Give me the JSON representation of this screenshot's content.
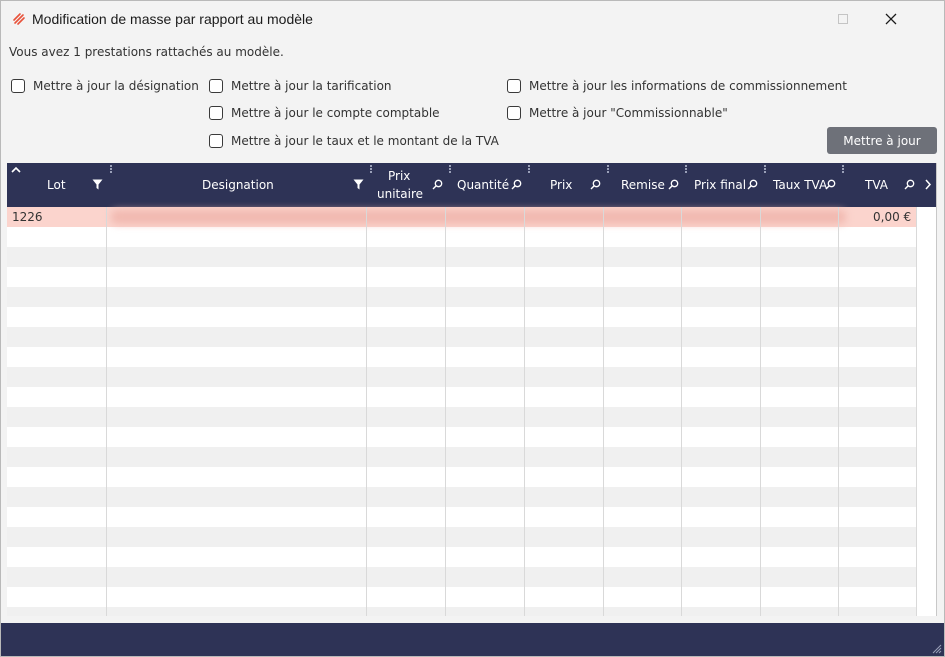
{
  "window": {
    "title": "Modification de masse par rapport au modèle",
    "minimize_icon": "minimize-icon",
    "maximize_icon": "maximize-icon",
    "close_icon": "close-icon"
  },
  "info_text": "Vous avez 1 prestations rattachés au modèle.",
  "options": [
    {
      "label": "Mettre à jour la désignation",
      "checked": false
    },
    {
      "label": "Mettre à jour la tarification",
      "checked": false
    },
    {
      "label": "Mettre à jour le compte comptable",
      "checked": false
    },
    {
      "label": "Mettre à jour le taux et le montant de la TVA",
      "checked": false
    },
    {
      "label": "Mettre à jour les informations de commissionnement",
      "checked": false
    },
    {
      "label": "Mettre à jour \"Commissionnable\"",
      "checked": false
    }
  ],
  "update_button": "Mettre à jour",
  "table": {
    "columns": [
      {
        "label": "Lot",
        "icon": "filter-icon"
      },
      {
        "label": "Designation",
        "icon": "filter-icon"
      },
      {
        "label": "Prix unitaire",
        "line1": "Prix",
        "line2": "unitaire",
        "icon": "search-icon"
      },
      {
        "label": "Quantité",
        "icon": "search-icon"
      },
      {
        "label": "Prix",
        "icon": "search-icon"
      },
      {
        "label": "Remise",
        "icon": "search-icon"
      },
      {
        "label": "Prix final",
        "icon": "search-icon"
      },
      {
        "label": "Taux TVA",
        "icon": "search-icon"
      },
      {
        "label": "TVA",
        "icon": "search-icon"
      }
    ],
    "rows": [
      {
        "lot": "1226",
        "designation": "",
        "tva": "0,00 €",
        "selected": true
      }
    ],
    "sort_icon": "sort-up-icon",
    "scroll_right_icon": "chevron-right-icon"
  },
  "colors": {
    "header_bg": "#2e3356",
    "selected_row": "#fbd4cd",
    "button_bg": "#6e7179",
    "app_icon": "#e8523a"
  }
}
